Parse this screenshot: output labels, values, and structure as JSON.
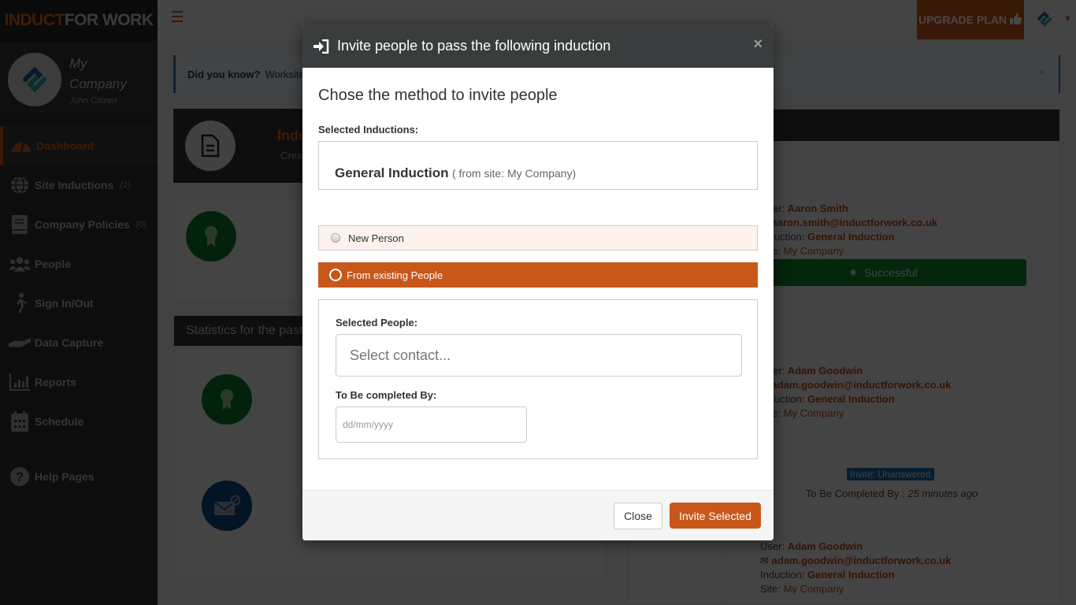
{
  "brand": {
    "part1": "INDUCT",
    "part2": "FOR WORK"
  },
  "profile": {
    "company": "My Company",
    "user": "John Citizen"
  },
  "sidebar": {
    "items": [
      {
        "label": "Dashboard",
        "icon": "dashboard-gauge-icon",
        "count": "",
        "active": true
      },
      {
        "label": "Site Inductions",
        "icon": "globe-icon",
        "count": "(1)"
      },
      {
        "label": "Company Policies",
        "icon": "book-icon",
        "count": "(0)"
      },
      {
        "label": "People",
        "icon": "users-icon",
        "count": ""
      },
      {
        "label": "Sign In/Out",
        "icon": "walking-person-icon",
        "count": ""
      },
      {
        "label": "Data Capture",
        "icon": "hand-icon",
        "count": ""
      },
      {
        "label": "Reports",
        "icon": "bar-chart-icon",
        "count": ""
      },
      {
        "label": "Schedule",
        "icon": "calendar-icon",
        "count": ""
      },
      {
        "label": "Help Pages",
        "icon": "question-circle-icon",
        "count": ""
      }
    ]
  },
  "topbar": {
    "upgrade_label": "UPGRADE PLAN"
  },
  "tip": {
    "title": "Did you know?",
    "text": "Worksite"
  },
  "dashboard": {
    "card_title": "Indu",
    "card_sub": "Crea",
    "stats_title": "Statistics for the past"
  },
  "activity": [
    {
      "user_label": "User:",
      "user": "Aaron Smith",
      "email": "aaron.smith@inductforwork.co.uk",
      "induction_label": "Induction:",
      "induction": "General Induction",
      "site_label": "Site:",
      "site": "My Company",
      "status": "Successful"
    },
    {
      "user_label": "User:",
      "user": "Adam Goodwin",
      "email": "adam.goodwin@inductforwork.co.uk",
      "induction_label": "Induction:",
      "induction": "General Induction",
      "site_label": "Site:",
      "site": "My Company",
      "status": "Invite: Unanswered",
      "complete_by_label": "To Be Completed By :",
      "complete_by": "25 minutes ago"
    },
    {
      "user_label": "User:",
      "user": "Adam Goodwin",
      "email": "adam.goodwin@inductforwork.co.uk",
      "induction_label": "Induction:",
      "induction": "General Induction",
      "site_label": "Site:",
      "site": "My Company"
    }
  ],
  "modal": {
    "title": "Invite people to pass the following induction",
    "subheading": "Chose the method to invite people",
    "selected_inductions_label": "Selected Inductions:",
    "induction_name": "General Induction",
    "induction_site": "( from site: My Company)",
    "option_new": "New Person",
    "option_existing": "From existing People",
    "selected_method": "From existing People",
    "selected_people_label": "Selected People:",
    "contact_placeholder": "Select contact...",
    "contact_value": "",
    "complete_by_label": "To Be completed By:",
    "date_placeholder": "dd/mm/yyyy",
    "date_value": "",
    "close_label": "Close",
    "invite_label": "Invite Selected"
  },
  "colors": {
    "accent": "#c8571a",
    "success": "#0d8a2e",
    "info": "#1c6aa8",
    "header": "#3a3d3e"
  }
}
